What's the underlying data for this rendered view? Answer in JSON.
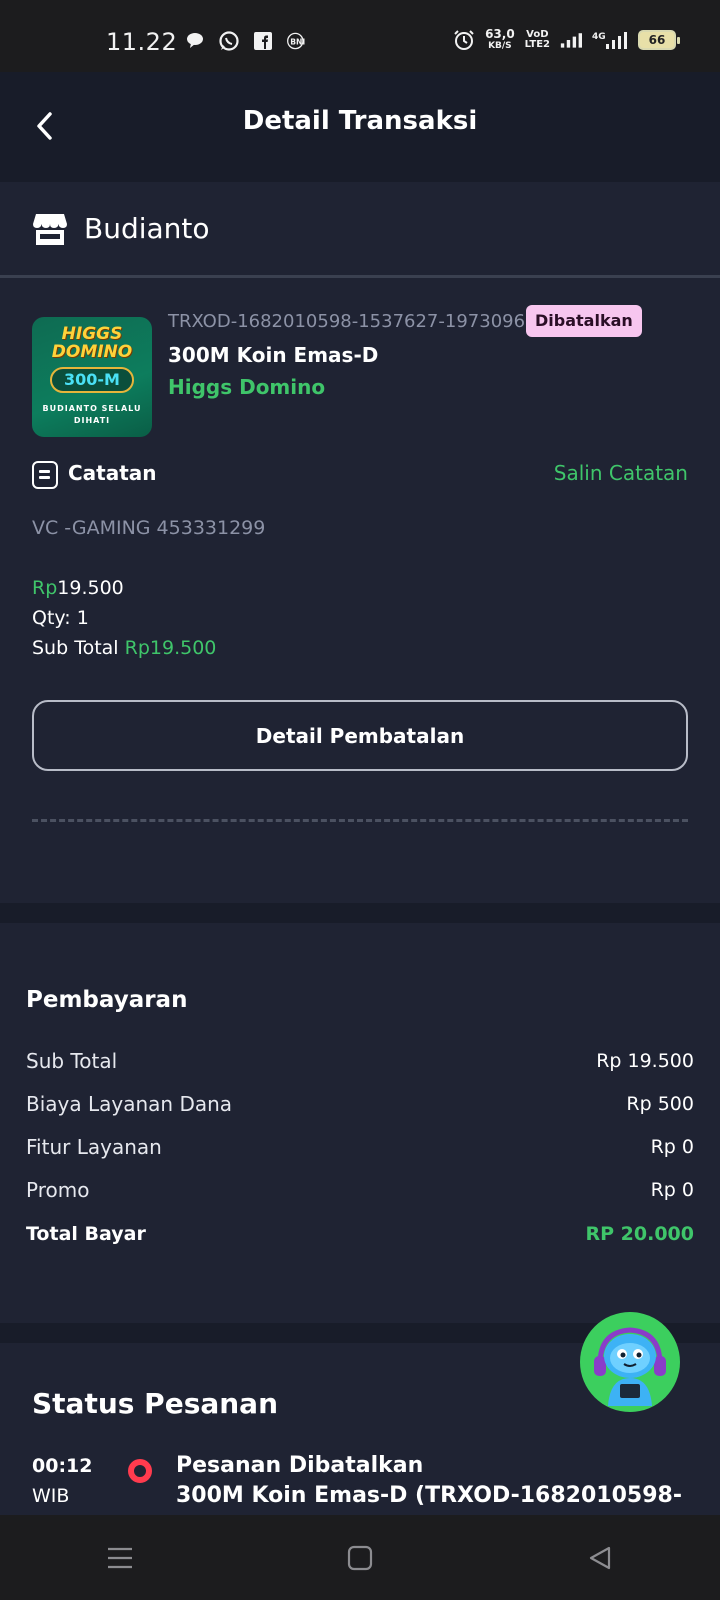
{
  "status_bar": {
    "time": "11.22",
    "net_speed_value": "63,0",
    "net_speed_unit": "KB/S",
    "volte_top": "VoD",
    "volte_bottom": "LTE2",
    "network_type": "4G",
    "battery_level": "66"
  },
  "header": {
    "title": "Detail Transaksi"
  },
  "store": {
    "name": "Budianto"
  },
  "product": {
    "thumb_title": "HIGGS DOMINO",
    "thumb_amount": "300-M",
    "thumb_caption": "BUDIANTO SELALU DIHATI",
    "transaction_id": "TRXOD-1682010598-1537627-1973096",
    "status": "Dibatalkan",
    "name": "300M Koin Emas-D",
    "game": "Higgs Domino"
  },
  "note": {
    "label": "Catatan",
    "copy_label": "Salin Catatan",
    "text": "VC -GAMING 453331299"
  },
  "pricing": {
    "currency": "Rp",
    "price": "19.500",
    "qty_label": "Qty: 1",
    "subtotal_label": "Sub Total",
    "subtotal_value": "Rp19.500"
  },
  "cancel_detail_button": "Detail Pembatalan",
  "payment": {
    "title": "Pembayaran",
    "rows": [
      {
        "label": "Sub Total",
        "value": "Rp 19.500"
      },
      {
        "label": "Biaya Layanan Dana",
        "value": "Rp 500"
      },
      {
        "label": "Fitur Layanan",
        "value": "Rp 0"
      },
      {
        "label": "Promo",
        "value": "Rp 0"
      }
    ],
    "total_label": "Total Bayar",
    "total_value": "RP 20.000"
  },
  "order_status": {
    "title": "Status Pesanan",
    "events": [
      {
        "time": "00:12",
        "zone": "WIB",
        "title": "Pesanan Dibatalkan",
        "description": "300M Koin Emas-D (TRXOD-1682010598-"
      }
    ]
  },
  "colors": {
    "background": "#1f2333",
    "header_bg": "#181c29",
    "accent_green": "#3fc56a",
    "badge_pink": "#f7c6ef",
    "status_red": "#ff3b4e"
  },
  "icons": {
    "back": "chevron-left-icon",
    "store": "store-icon",
    "note": "note-icon",
    "status_dot": "status-dot-icon",
    "assistant": "robot-assistant-icon",
    "nav": [
      "menu-icon",
      "home-square-icon",
      "back-triangle-icon"
    ]
  }
}
